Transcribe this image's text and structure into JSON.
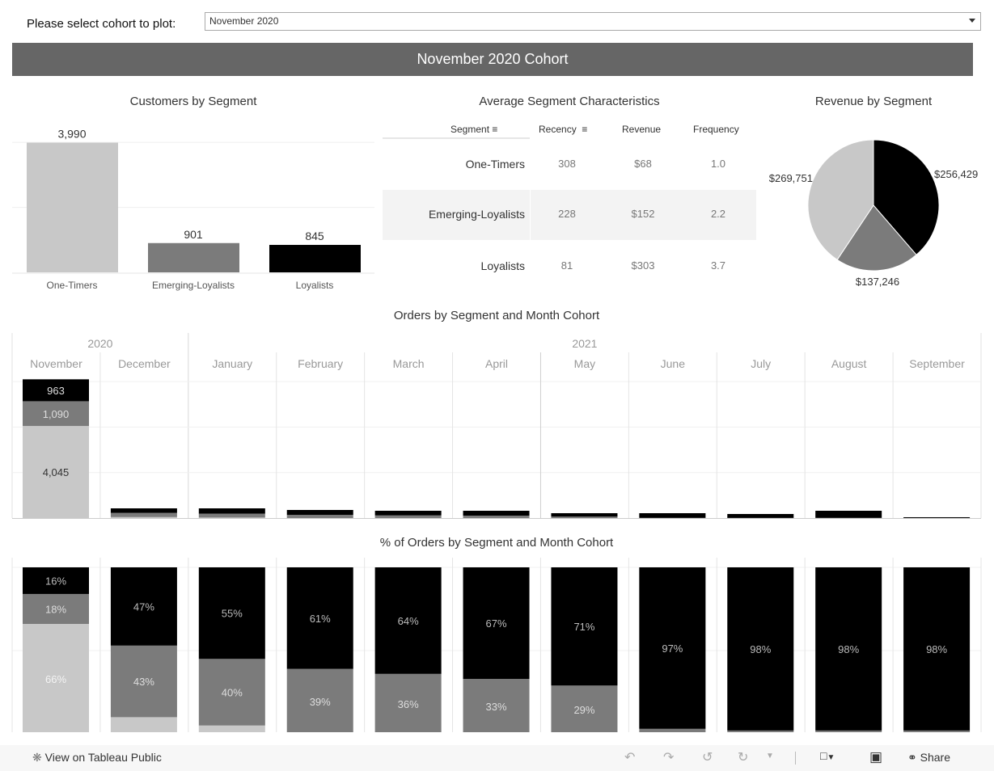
{
  "filter": {
    "label": "Please select cohort to plot:",
    "selected": "November 2020"
  },
  "banner": "November 2020 Cohort",
  "colors": {
    "One-Timers": "#c8c8c8",
    "Emerging-Loyalists": "#7b7b7b",
    "Loyalists": "#000000",
    "banner": "#666666"
  },
  "table": {
    "title": "Average Segment Characteristics",
    "headers": [
      "Segment",
      "Recency",
      "Revenue",
      "Frequency"
    ],
    "rows": [
      [
        "One-Timers",
        "308",
        "$68",
        "1.0"
      ],
      [
        "Emerging-Loyalists",
        "228",
        "$152",
        "2.2"
      ],
      [
        "Loyalists",
        "81",
        "$303",
        "3.7"
      ]
    ]
  },
  "chart_data": [
    {
      "type": "bar",
      "title": "Customers by Segment",
      "categories": [
        "One-Timers",
        "Emerging-Loyalists",
        "Loyalists"
      ],
      "values": [
        3990,
        901,
        845
      ],
      "labels": [
        "3,990",
        "901",
        "845"
      ],
      "ylim": [
        0,
        4700
      ],
      "grid": true
    },
    {
      "type": "pie",
      "title": "Revenue by Segment",
      "categories": [
        "Loyalists",
        "Emerging-Loyalists",
        "One-Timers"
      ],
      "values": [
        256429,
        137246,
        269751
      ],
      "labels": [
        "$256,429",
        "$137,246",
        "$269,751"
      ]
    },
    {
      "type": "bar",
      "stacked": true,
      "title": "Orders by Segment and Month Cohort",
      "years": [
        {
          "label": "2020",
          "span": 2
        },
        {
          "label": "2021",
          "span": 9
        }
      ],
      "categories": [
        "November",
        "December",
        "January",
        "February",
        "March",
        "April",
        "May",
        "June",
        "July",
        "August",
        "September"
      ],
      "series": [
        {
          "name": "One-Timers",
          "values": [
            4045,
            43,
            22,
            0,
            0,
            0,
            0,
            0,
            0,
            0,
            0
          ],
          "labels": [
            "4,045"
          ]
        },
        {
          "name": "Emerging-Loyalists",
          "values": [
            1090,
            183,
            170,
            138,
            115,
            106,
            62,
            6,
            4,
            6,
            1
          ],
          "labels": [
            "1,090"
          ]
        },
        {
          "name": "Loyalists",
          "values": [
            963,
            200,
            234,
            217,
            205,
            214,
            151,
            207,
            174,
            314,
            35
          ],
          "labels": [
            "963"
          ]
        }
      ],
      "ylim": [
        0,
        6400
      ],
      "grid": true
    },
    {
      "type": "bar",
      "stacked": true,
      "title": "% of Orders by Segment and Month Cohort",
      "categories": [
        "November",
        "December",
        "January",
        "February",
        "March",
        "April",
        "May",
        "June",
        "July",
        "August",
        "September"
      ],
      "series": [
        {
          "name": "One-Timers",
          "values": [
            66,
            10,
            5,
            0,
            0,
            0,
            0,
            0,
            0,
            0,
            0
          ],
          "labels": [
            "66%",
            null,
            null,
            null,
            null,
            null,
            null,
            null,
            null,
            null,
            null
          ]
        },
        {
          "name": "Emerging-Loyalists",
          "values": [
            18,
            43,
            40,
            39,
            36,
            33,
            29,
            3,
            2,
            2,
            2
          ],
          "labels": [
            "18%",
            "43%",
            "40%",
            "39%",
            "36%",
            "33%",
            "29%",
            null,
            null,
            null,
            null
          ]
        },
        {
          "name": "Loyalists",
          "values": [
            16,
            47,
            55,
            61,
            64,
            67,
            71,
            97,
            98,
            98,
            98
          ],
          "labels": [
            "16%",
            "47%",
            "55%",
            "61%",
            "64%",
            "67%",
            "71%",
            "97%",
            "98%",
            "98%",
            "98%"
          ]
        }
      ],
      "ylim": [
        0,
        100
      ],
      "grid": true
    }
  ],
  "footer": {
    "view_label": "View on Tableau Public",
    "share_label": "Share",
    "icons": [
      "tableau-logo-icon",
      "undo-icon",
      "redo-icon",
      "revert-icon",
      "refresh-icon",
      "download-icon",
      "fullscreen-icon",
      "share-icon"
    ]
  }
}
